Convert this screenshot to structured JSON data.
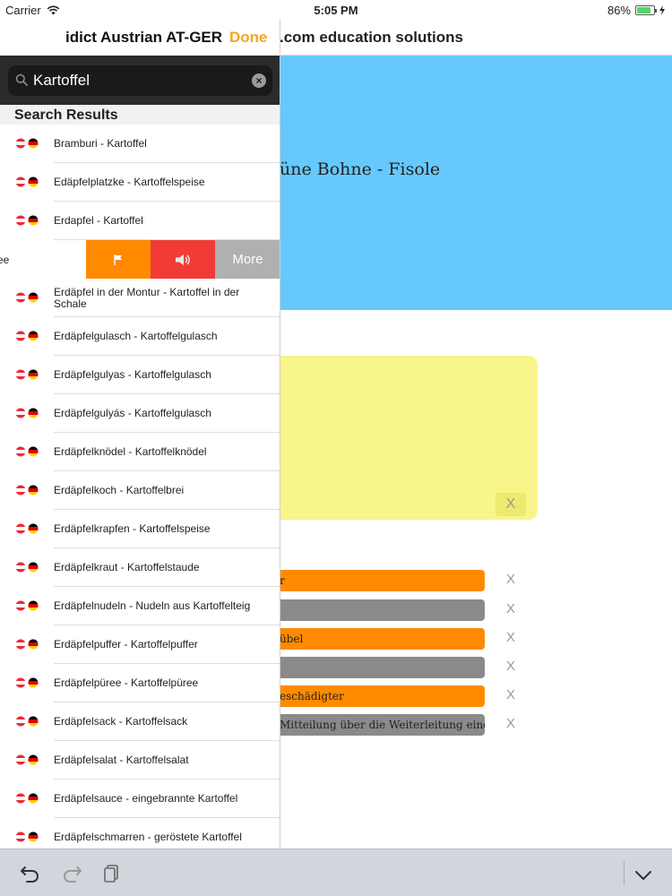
{
  "status_bar": {
    "carrier": "Carrier",
    "time": "5:05 PM",
    "battery": "86%",
    "battery_level": 0.86
  },
  "background": {
    "nav_title": ".com education solutions",
    "word_pair_text": "üne Bohne - Fisole",
    "yellow_card_close": "X",
    "bars": [
      {
        "text": "r",
        "color": "#ff8a00",
        "close": "X"
      },
      {
        "text": "",
        "color": "#8a8a8a",
        "close": "X"
      },
      {
        "text": "übel",
        "color": "#ff8a00",
        "close": "X"
      },
      {
        "text": "",
        "color": "#8a8a8a",
        "close": "X"
      },
      {
        "text": "eschädigter",
        "color": "#ff8a00",
        "close": "X"
      },
      {
        "text": "Mitteilung über die Weiterleitung eines",
        "color": "#8a8a8a",
        "close": "X"
      }
    ]
  },
  "popover": {
    "title": "idict Austrian AT-GER",
    "done_label": "Done",
    "search": {
      "value": "Kartoffel"
    },
    "section_header": "Search Results",
    "results": [
      "Bramburi - Kartoffel",
      "Edäpfelplatzke - Kartoffelspeise",
      "Erdapfel - Kartoffel"
    ],
    "swiped_row": {
      "text": "ee",
      "actions": {
        "flag_icon": "flag-icon",
        "speak_icon": "speaker-icon",
        "more": "More"
      }
    },
    "results_after": [
      "Erdäpfel in der Montur - Kartoffel in der Schale",
      "Erdäpfelgulasch - Kartoffelgulasch",
      "Erdäpfelgulyas - Kartoffelgulasch",
      "Erdäpfelgulyás - Kartoffelgulasch",
      "Erdäpfelknödel - Kartoffelknödel",
      "Erdäpfelkoch - Kartoffelbrei",
      "Erdäpfelkrapfen - Kartoffelspeise",
      "Erdäpfelkraut - Kartoffelstaude",
      "Erdäpfelnudeln - Nudeln aus Kartoffelteig",
      "Erdäpfelpuffer - Kartoffelpuffer",
      "Erdäpfelpüree - Kartoffelpüree",
      "Erdäpfelsack - Kartoffelsack",
      "Erdäpfelsalat - Kartoffelsalat",
      "Erdäpfelsauce - eingebrannte Kartoffel",
      "Erdäpfelschmarren - geröstete Kartoffel"
    ]
  },
  "toolbar": {
    "icons": [
      "undo-icon",
      "redo-icon",
      "clipboard-icon",
      "chevron-down-icon"
    ]
  },
  "colors": {
    "accent": "#f7a51c",
    "blue": "#66c8fc",
    "yellow": "#f8f58a",
    "orange": "#ff8a00",
    "red": "#f23b37"
  }
}
